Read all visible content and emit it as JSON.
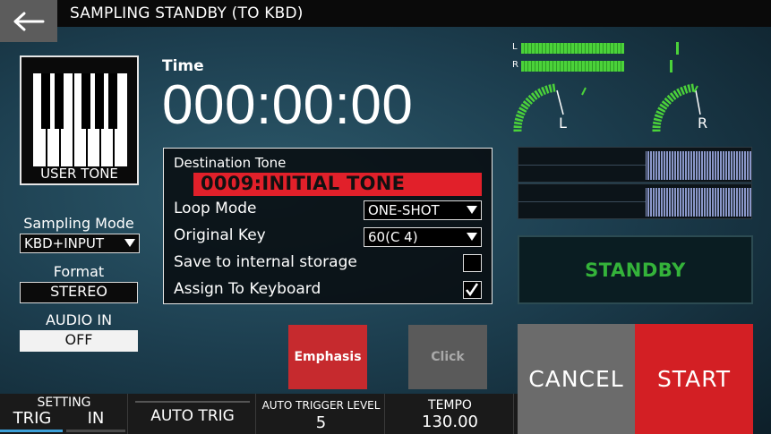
{
  "header": {
    "title": "SAMPLING STANDBY (TO KBD)"
  },
  "tone_box": {
    "label": "USER TONE"
  },
  "sampling_mode": {
    "label": "Sampling Mode",
    "value": "KBD+INPUT"
  },
  "format": {
    "label": "Format",
    "value": "STEREO"
  },
  "audio_in": {
    "label": "AUDIO IN",
    "value": "OFF"
  },
  "time": {
    "label": "Time",
    "value": "000:00:00"
  },
  "destination": {
    "label": "Destination Tone",
    "tone": "0009:INITIAL TONE",
    "loop_mode": {
      "label": "Loop Mode",
      "value": "ONE-SHOT"
    },
    "original_key": {
      "label": "Original Key",
      "value": "60(C 4)"
    },
    "save_internal": {
      "label": "Save to internal storage",
      "checked": false
    },
    "assign_keyboard": {
      "label": "Assign To Keyboard",
      "checked": true
    }
  },
  "meters": {
    "left_label": "L",
    "right_label": "R",
    "left_level": 0.64,
    "right_level": 0.64,
    "left_peak": 0.96,
    "right_peak": 0.92
  },
  "dials": {
    "left_label": "L",
    "right_label": "R"
  },
  "buttons": {
    "standby": "STANDBY",
    "emphasis": "Emphasis",
    "click": "Click",
    "cancel": "CANCEL",
    "start": "START"
  },
  "bottom": {
    "setting_label": "SETTING",
    "trig_label": "TRIG",
    "in_label": "IN",
    "auto_trig": "AUTO TRIG",
    "auto_trigger_level_label": "AUTO TRIGGER LEVEL",
    "auto_trigger_level_value": "5",
    "tempo_label": "TEMPO",
    "tempo_value": "130.00"
  },
  "colors": {
    "accent_red": "#e1202a",
    "meter_green": "#4bd23a",
    "standby_green": "#34b33a"
  },
  "icons": {
    "back": "back-arrow-icon",
    "keyboard": "piano-keyboard-icon",
    "dropdown": "chevron-down-icon",
    "check": "checkmark-icon"
  }
}
